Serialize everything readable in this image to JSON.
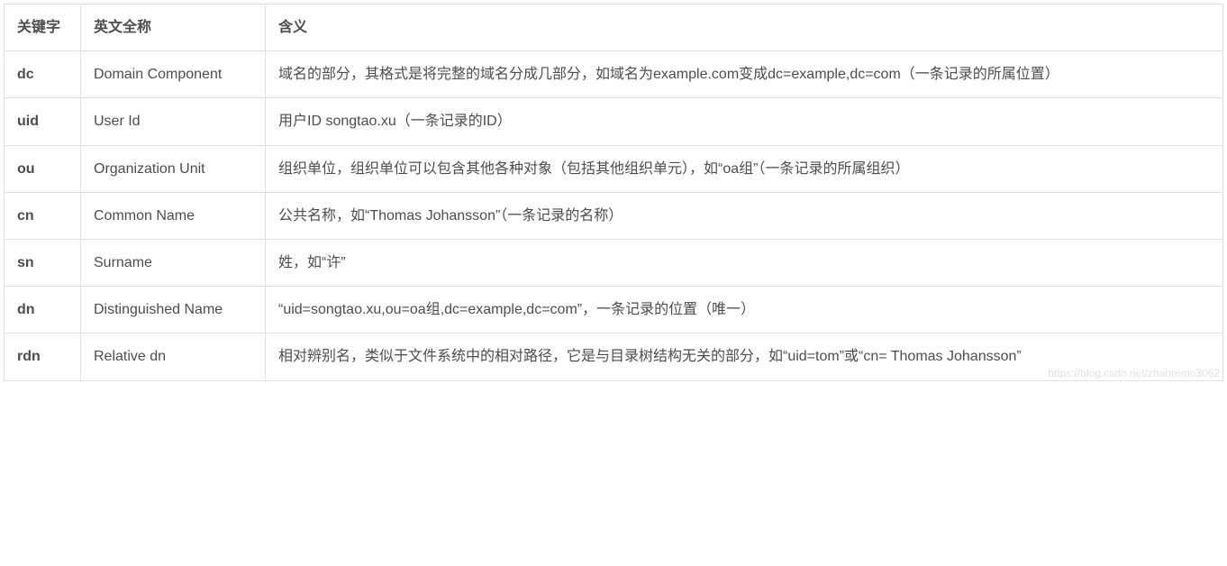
{
  "table": {
    "headers": {
      "keyword": "关键字",
      "english_full_name": "英文全称",
      "meaning": "含义"
    },
    "rows": [
      {
        "keyword": "dc",
        "english": "Domain Component",
        "meaning": "域名的部分，其格式是将完整的域名分成几部分，如域名为example.com变成dc=example,dc=com（一条记录的所属位置）"
      },
      {
        "keyword": "uid",
        "english": "User Id",
        "meaning": "用户ID songtao.xu（一条记录的ID）"
      },
      {
        "keyword": "ou",
        "english": "Organization Unit",
        "meaning": "组织单位，组织单位可以包含其他各种对象（包括其他组织单元），如“oa组”（一条记录的所属组织）"
      },
      {
        "keyword": "cn",
        "english": "Common Name",
        "meaning": "公共名称，如“Thomas Johansson”（一条记录的名称）"
      },
      {
        "keyword": "sn",
        "english": "Surname",
        "meaning": "姓，如“许”"
      },
      {
        "keyword": "dn",
        "english": "Distinguished Name",
        "meaning": "“uid=songtao.xu,ou=oa组,dc=example,dc=com”，一条记录的位置（唯一）"
      },
      {
        "keyword": "rdn",
        "english": "Relative dn",
        "meaning": "相对辨别名，类似于文件系统中的相对路径，它是与目录树结构无关的部分，如“uid=tom”或“cn= Thomas Johansson”"
      }
    ]
  },
  "watermark": "https://blog.csdn.net/zhanremo3062"
}
